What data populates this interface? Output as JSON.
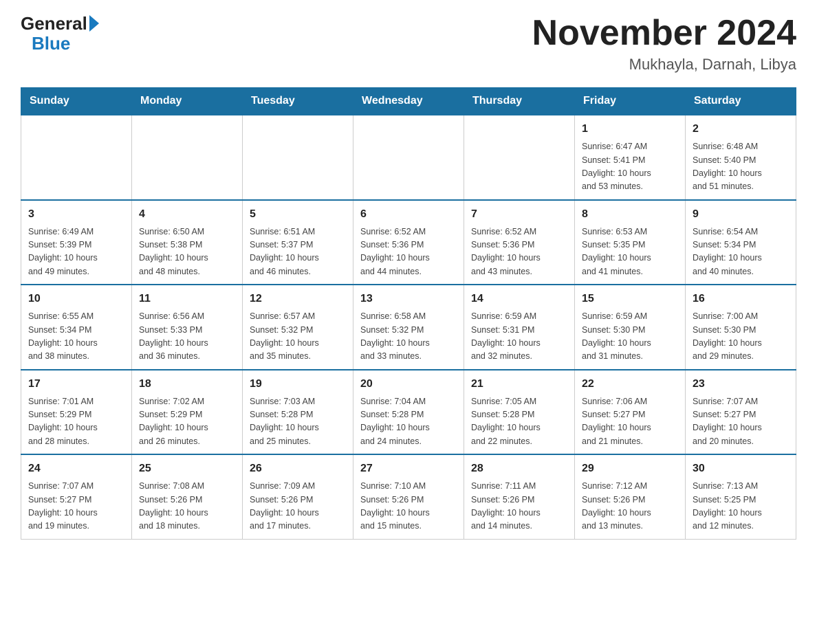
{
  "header": {
    "month_title": "November 2024",
    "location": "Mukhayla, Darnah, Libya",
    "logo_general": "General",
    "logo_blue": "Blue"
  },
  "days_of_week": [
    "Sunday",
    "Monday",
    "Tuesday",
    "Wednesday",
    "Thursday",
    "Friday",
    "Saturday"
  ],
  "weeks": [
    {
      "days": [
        {
          "number": "",
          "info": ""
        },
        {
          "number": "",
          "info": ""
        },
        {
          "number": "",
          "info": ""
        },
        {
          "number": "",
          "info": ""
        },
        {
          "number": "",
          "info": ""
        },
        {
          "number": "1",
          "info": "Sunrise: 6:47 AM\nSunset: 5:41 PM\nDaylight: 10 hours\nand 53 minutes."
        },
        {
          "number": "2",
          "info": "Sunrise: 6:48 AM\nSunset: 5:40 PM\nDaylight: 10 hours\nand 51 minutes."
        }
      ]
    },
    {
      "days": [
        {
          "number": "3",
          "info": "Sunrise: 6:49 AM\nSunset: 5:39 PM\nDaylight: 10 hours\nand 49 minutes."
        },
        {
          "number": "4",
          "info": "Sunrise: 6:50 AM\nSunset: 5:38 PM\nDaylight: 10 hours\nand 48 minutes."
        },
        {
          "number": "5",
          "info": "Sunrise: 6:51 AM\nSunset: 5:37 PM\nDaylight: 10 hours\nand 46 minutes."
        },
        {
          "number": "6",
          "info": "Sunrise: 6:52 AM\nSunset: 5:36 PM\nDaylight: 10 hours\nand 44 minutes."
        },
        {
          "number": "7",
          "info": "Sunrise: 6:52 AM\nSunset: 5:36 PM\nDaylight: 10 hours\nand 43 minutes."
        },
        {
          "number": "8",
          "info": "Sunrise: 6:53 AM\nSunset: 5:35 PM\nDaylight: 10 hours\nand 41 minutes."
        },
        {
          "number": "9",
          "info": "Sunrise: 6:54 AM\nSunset: 5:34 PM\nDaylight: 10 hours\nand 40 minutes."
        }
      ]
    },
    {
      "days": [
        {
          "number": "10",
          "info": "Sunrise: 6:55 AM\nSunset: 5:34 PM\nDaylight: 10 hours\nand 38 minutes."
        },
        {
          "number": "11",
          "info": "Sunrise: 6:56 AM\nSunset: 5:33 PM\nDaylight: 10 hours\nand 36 minutes."
        },
        {
          "number": "12",
          "info": "Sunrise: 6:57 AM\nSunset: 5:32 PM\nDaylight: 10 hours\nand 35 minutes."
        },
        {
          "number": "13",
          "info": "Sunrise: 6:58 AM\nSunset: 5:32 PM\nDaylight: 10 hours\nand 33 minutes."
        },
        {
          "number": "14",
          "info": "Sunrise: 6:59 AM\nSunset: 5:31 PM\nDaylight: 10 hours\nand 32 minutes."
        },
        {
          "number": "15",
          "info": "Sunrise: 6:59 AM\nSunset: 5:30 PM\nDaylight: 10 hours\nand 31 minutes."
        },
        {
          "number": "16",
          "info": "Sunrise: 7:00 AM\nSunset: 5:30 PM\nDaylight: 10 hours\nand 29 minutes."
        }
      ]
    },
    {
      "days": [
        {
          "number": "17",
          "info": "Sunrise: 7:01 AM\nSunset: 5:29 PM\nDaylight: 10 hours\nand 28 minutes."
        },
        {
          "number": "18",
          "info": "Sunrise: 7:02 AM\nSunset: 5:29 PM\nDaylight: 10 hours\nand 26 minutes."
        },
        {
          "number": "19",
          "info": "Sunrise: 7:03 AM\nSunset: 5:28 PM\nDaylight: 10 hours\nand 25 minutes."
        },
        {
          "number": "20",
          "info": "Sunrise: 7:04 AM\nSunset: 5:28 PM\nDaylight: 10 hours\nand 24 minutes."
        },
        {
          "number": "21",
          "info": "Sunrise: 7:05 AM\nSunset: 5:28 PM\nDaylight: 10 hours\nand 22 minutes."
        },
        {
          "number": "22",
          "info": "Sunrise: 7:06 AM\nSunset: 5:27 PM\nDaylight: 10 hours\nand 21 minutes."
        },
        {
          "number": "23",
          "info": "Sunrise: 7:07 AM\nSunset: 5:27 PM\nDaylight: 10 hours\nand 20 minutes."
        }
      ]
    },
    {
      "days": [
        {
          "number": "24",
          "info": "Sunrise: 7:07 AM\nSunset: 5:27 PM\nDaylight: 10 hours\nand 19 minutes."
        },
        {
          "number": "25",
          "info": "Sunrise: 7:08 AM\nSunset: 5:26 PM\nDaylight: 10 hours\nand 18 minutes."
        },
        {
          "number": "26",
          "info": "Sunrise: 7:09 AM\nSunset: 5:26 PM\nDaylight: 10 hours\nand 17 minutes."
        },
        {
          "number": "27",
          "info": "Sunrise: 7:10 AM\nSunset: 5:26 PM\nDaylight: 10 hours\nand 15 minutes."
        },
        {
          "number": "28",
          "info": "Sunrise: 7:11 AM\nSunset: 5:26 PM\nDaylight: 10 hours\nand 14 minutes."
        },
        {
          "number": "29",
          "info": "Sunrise: 7:12 AM\nSunset: 5:26 PM\nDaylight: 10 hours\nand 13 minutes."
        },
        {
          "number": "30",
          "info": "Sunrise: 7:13 AM\nSunset: 5:25 PM\nDaylight: 10 hours\nand 12 minutes."
        }
      ]
    }
  ]
}
